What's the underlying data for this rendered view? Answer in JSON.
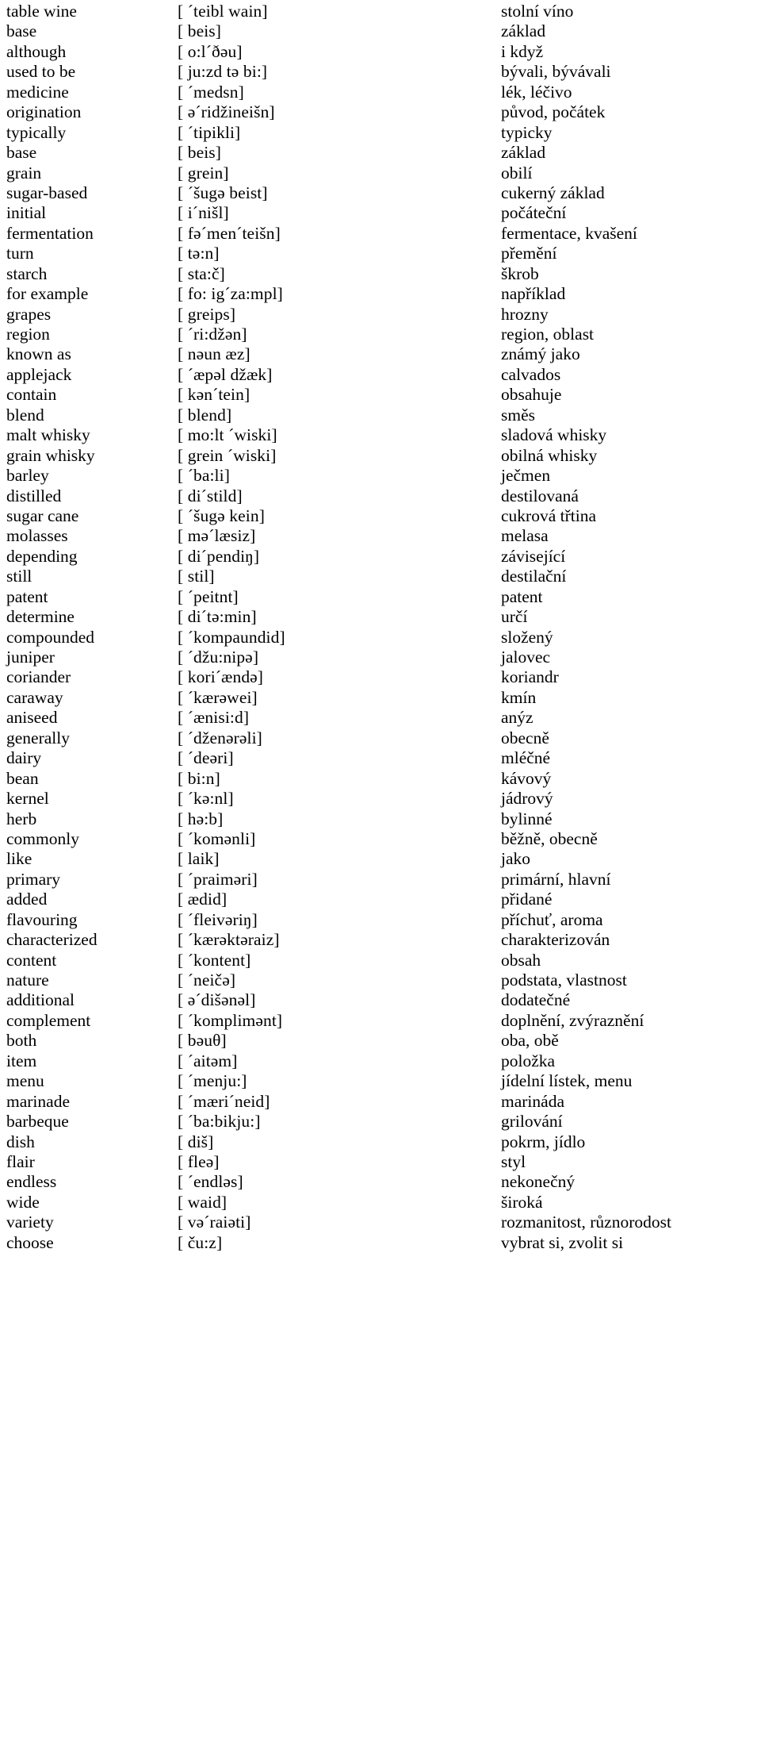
{
  "document": {
    "type": "vocabulary-glossary",
    "columns": [
      "english",
      "transcription",
      "czech"
    ],
    "entries": [
      {
        "english": "table wine",
        "transcription": "[ ´teibl wain]",
        "czech": "stolní víno"
      },
      {
        "english": "base",
        "transcription": "[ beis]",
        "czech": "základ"
      },
      {
        "english": "although",
        "transcription": "[ o:l´ðəu]",
        "czech": "i když"
      },
      {
        "english": "used to be",
        "transcription": "[ ju:zd tə bi:]",
        "czech": "bývali, bývávali"
      },
      {
        "english": "medicine",
        "transcription": "[ ´medsn]",
        "czech": "lék, léčivo"
      },
      {
        "english": "origination",
        "transcription": "[ ə´ridžineišn]",
        "czech": "původ, počátek"
      },
      {
        "english": "typically",
        "transcription": "[ ´tipikli]",
        "czech": "typicky"
      },
      {
        "english": "base",
        "transcription": "[ beis]",
        "czech": "základ"
      },
      {
        "english": "grain",
        "transcription": "[ grein]",
        "czech": "obilí"
      },
      {
        "english": "sugar-based",
        "transcription": "[ ´šugə beist]",
        "czech": "cukerný základ"
      },
      {
        "english": "initial",
        "transcription": "[ i´nišl]",
        "czech": "počáteční"
      },
      {
        "english": "fermentation",
        "transcription": "[ fə´men´teišn]",
        "czech": "fermentace, kvašení"
      },
      {
        "english": "turn",
        "transcription": "[ tə:n]",
        "czech": "přemění"
      },
      {
        "english": "starch",
        "transcription": "[ sta:č]",
        "czech": "škrob"
      },
      {
        "english": "for example",
        "transcription": "[ fo: ig´za:mpl]",
        "czech": "například"
      },
      {
        "english": "grapes",
        "transcription": "[ greips]",
        "czech": "hrozny"
      },
      {
        "english": "region",
        "transcription": "[ ´ri:džən]",
        "czech": "region, oblast"
      },
      {
        "english": "known as",
        "transcription": "[ nəun æz]",
        "czech": "známý jako"
      },
      {
        "english": "applejack",
        "transcription": "[ ´æpəl džæk]",
        "czech": "calvados"
      },
      {
        "english": "contain",
        "transcription": "[ kən´tein]",
        "czech": "obsahuje"
      },
      {
        "english": "blend",
        "transcription": "[ blend]",
        "czech": "směs"
      },
      {
        "english": "malt whisky",
        "transcription": "[ mo:lt ´wiski]",
        "czech": "sladová whisky"
      },
      {
        "english": "grain whisky",
        "transcription": "[ grein ´wiski]",
        "czech": "obilná whisky"
      },
      {
        "english": "barley",
        "transcription": "[ ´ba:li]",
        "czech": "ječmen"
      },
      {
        "english": "distilled",
        "transcription": "[ di´stild]",
        "czech": "destilovaná"
      },
      {
        "english": "sugar cane",
        "transcription": "[ ´šugə kein]",
        "czech": "cukrová třtina"
      },
      {
        "english": "molasses",
        "transcription": "[ mə´læsiz]",
        "czech": "melasa"
      },
      {
        "english": "depending",
        "transcription": "[ di´pendiŋ]",
        "czech": "závisející"
      },
      {
        "english": "still",
        "transcription": "[ stil]",
        "czech": "destilační"
      },
      {
        "english": "patent",
        "transcription": "[ ´peitnt]",
        "czech": "patent"
      },
      {
        "english": "determine",
        "transcription": "[ di´tə:min]",
        "czech": "určí"
      },
      {
        "english": "compounded",
        "transcription": "[ ´kompaundid]",
        "czech": "složený"
      },
      {
        "english": "juniper",
        "transcription": "[ ´džu:nipə]",
        "czech": "jalovec"
      },
      {
        "english": "coriander",
        "transcription": "[ kori´ændə]",
        "czech": "koriandr"
      },
      {
        "english": "caraway",
        "transcription": "[ ´kærəwei]",
        "czech": "kmín"
      },
      {
        "english": "aniseed",
        "transcription": "[ ´ænisi:d]",
        "czech": "anýz"
      },
      {
        "english": "generally",
        "transcription": "[ ´dženərəli]",
        "czech": "obecně"
      },
      {
        "english": "dairy",
        "transcription": "[ ´deəri]",
        "czech": "mléčné"
      },
      {
        "english": "bean",
        "transcription": "[ bi:n]",
        "czech": "kávový"
      },
      {
        "english": "kernel",
        "transcription": "[ ´kə:nl]",
        "czech": "jádrový"
      },
      {
        "english": "herb",
        "transcription": "[ hə:b]",
        "czech": "bylinné"
      },
      {
        "english": "commonly",
        "transcription": "[ ´komənli]",
        "czech": "běžně, obecně"
      },
      {
        "english": "like",
        "transcription": "[ laik]",
        "czech": "jako"
      },
      {
        "english": "primary",
        "transcription": "[ ´praiməri]",
        "czech": "primární, hlavní"
      },
      {
        "english": "added",
        "transcription": "[ ædid]",
        "czech": "přidané"
      },
      {
        "english": "flavouring",
        "transcription": "[ ´fleivəriŋ]",
        "czech": "příchuť, aroma"
      },
      {
        "english": "characterized",
        "transcription": "[ ´kærəktəraiz]",
        "czech": "charakterizován"
      },
      {
        "english": "content",
        "transcription": "[ ´kontent]",
        "czech": "obsah"
      },
      {
        "english": "nature",
        "transcription": "[ ´neičə]",
        "czech": "podstata, vlastnost"
      },
      {
        "english": "additional",
        "transcription": "[ ə´dišənəl]",
        "czech": "dodatečné"
      },
      {
        "english": "complement",
        "transcription": "[ ´komplimənt]",
        "czech": "doplnění, zvýraznění"
      },
      {
        "english": "both",
        "transcription": "[ bəuθ]",
        "czech": "oba, obě"
      },
      {
        "english": "item",
        "transcription": "[ ´aitəm]",
        "czech": "položka"
      },
      {
        "english": "menu",
        "transcription": "[ ´menju:]",
        "czech": "jídelní lístek, menu"
      },
      {
        "english": "marinade",
        "transcription": "[ ´mæri´neid]",
        "czech": "marináda"
      },
      {
        "english": "barbeque",
        "transcription": "[ ´ba:bikju:]",
        "czech": "grilování"
      },
      {
        "english": "dish",
        "transcription": "[ diš]",
        "czech": "pokrm, jídlo"
      },
      {
        "english": "flair",
        "transcription": "[ fleə]",
        "czech": "styl"
      },
      {
        "english": "endless",
        "transcription": "[ ´endləs]",
        "czech": "nekonečný"
      },
      {
        "english": "wide",
        "transcription": "[ waid]",
        "czech": "široká"
      },
      {
        "english": "variety",
        "transcription": "[ və´raiəti]",
        "czech": "rozmanitost, různorodost"
      },
      {
        "english": "choose",
        "transcription": "[ ču:z]",
        "czech": "vybrat si, zvolit si"
      }
    ]
  }
}
